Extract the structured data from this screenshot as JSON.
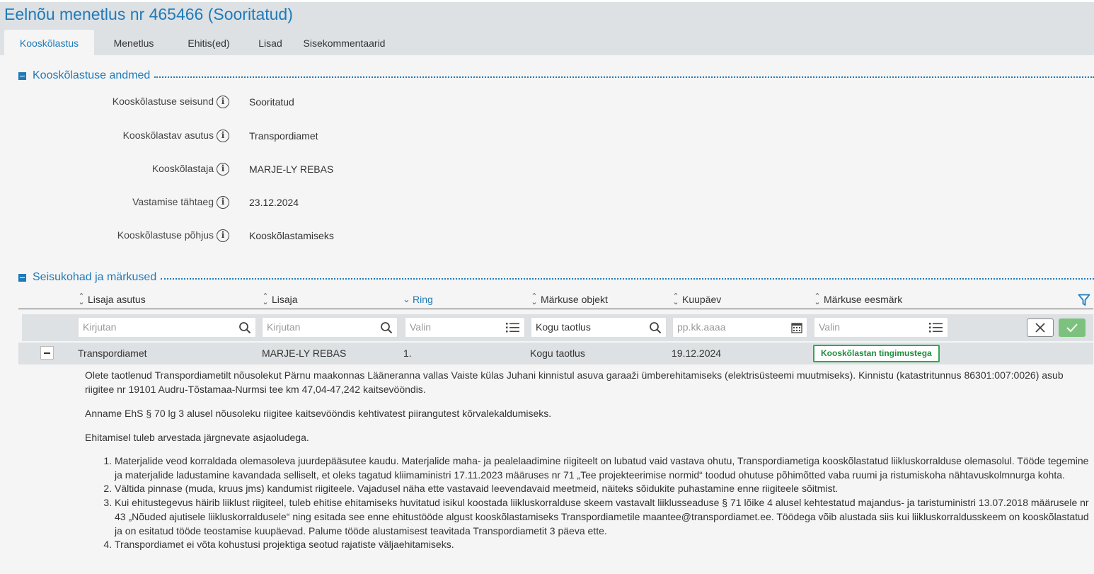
{
  "page": {
    "title": "Eelnõu menetlus nr 465466 (Sooritatud)"
  },
  "tabs": [
    {
      "label": "Kooskõlastus",
      "active": true
    },
    {
      "label": "Menetlus"
    },
    {
      "label": "Ehitis(ed)"
    },
    {
      "label": "Lisad"
    },
    {
      "label": "Sisekommentaarid"
    }
  ],
  "details": {
    "title": "Kooskõlastuse andmed",
    "fields": [
      {
        "label": "Kooskõlastuse seisund",
        "value": "Sooritatud"
      },
      {
        "label": "Kooskõlastav asutus",
        "value": "Transpordiamet"
      },
      {
        "label": "Kooskõlastaja",
        "value": "MARJE-LY REBAS"
      },
      {
        "label": "Vastamise tähtaeg",
        "value": "23.12.2024"
      },
      {
        "label": "Kooskõlastuse põhjus",
        "value": "Kooskõlastamiseks"
      }
    ]
  },
  "remarks": {
    "title": "Seisukohad ja märkused",
    "columns": [
      "Lisaja asutus",
      "Lisaja",
      "Ring",
      "Märkuse objekt",
      "Kuupäev",
      "Märkuse eesmärk"
    ],
    "sorted_column": "Ring",
    "filters": {
      "asutus_placeholder": "Kirjutan",
      "lisaja_placeholder": "Kirjutan",
      "ring_placeholder": "Valin",
      "objekt_value": "Kogu taotlus",
      "kuupaev_placeholder": "pp.kk.aaaa",
      "eesmark_placeholder": "Valin"
    },
    "row": {
      "asutus": "Transpordiamet",
      "lisaja": "MARJE-LY REBAS",
      "ring": "1.",
      "objekt": "Kogu taotlus",
      "kuupaev": "19.12.2024",
      "eesmark": "Kooskõlastan tingimustega"
    },
    "comment": {
      "p1": "Olete taotlenud Transpordiametilt nõusolekut Pärnu maakonnas Lääneranna vallas Vaiste külas Juhani kinnistul asuva garaaži ümberehitamiseks (elektrisüsteemi muutmiseks). Kinnistu (katastritunnus 86301:007:0026) asub riigitee nr 19101 Audru-Tõstamaa-Nurmsi tee km 47,04-47,242 kaitsevööndis.",
      "p2": "Anname EhS § 70 lg 3 alusel nõusoleku riigitee kaitsevööndis kehtivatest piirangutest kõrvalekaldumiseks.",
      "p3": "Ehitamisel tuleb arvestada järgnevate asjaoludega.",
      "items": [
        "Materjalide veod korraldada olemasoleva juurdepääsutee kaudu. Materjalide maha- ja pealelaadimine riigiteelt on lubatud vaid vastava ohutu, Transpordiametiga kooskõlastatud liikluskorralduse olemasolul. Tööde tegemine ja materjalide ladustamine kavandada selliselt, et oleks tagatud kliimaministri 17.11.2023 määruses nr 71 „Tee projekteerimise normid“ toodud ohutuse põhimõtted vaba ruumi ja ristumiskoha nähtavuskolmnurga kohta.",
        "Vältida pinnase (muda, kruus jms) kandumist riigiteele. Vajadusel näha ette vastavaid leevendavaid meetmeid, näiteks sõidukite puhastamine enne riigiteele sõitmist.",
        "Kui ehitustegevus häirib liiklust riigiteel, tuleb ehitise ehitamiseks huvitatud isikul koostada liikluskorralduse skeem vastavalt liiklusseaduse § 71 lõike 4 alusel kehtestatud majandus- ja taristuministri 13.07.2018 määrusele nr 43 „Nõuded ajutisele liikluskorraldusele“ ning esitada see enne ehitustööde algust kooskõlastamiseks Transpordiametile maantee@transpordiamet.ee. Töödega võib alustada siis kui liikluskorraldusskeem on kooskõlastatud ja on esitatud tööde teostamise kuupäevad. Palume tööde alustamisest teavitada Transpordiametit 3 päeva ette.",
        "Transpordiamet ei võta kohustusi projektiga seotud rajatiste väljaehitamiseks."
      ]
    }
  },
  "icons": {
    "info": "info-circle-icon",
    "search": "search-icon",
    "list": "list-icon",
    "calendar": "calendar-icon",
    "filter": "filter-icon",
    "clear": "close-icon",
    "confirm": "check-icon"
  },
  "colors": {
    "accent": "#1f7ab9",
    "success": "#2dab4d",
    "header_bg": "#dde1e4"
  }
}
